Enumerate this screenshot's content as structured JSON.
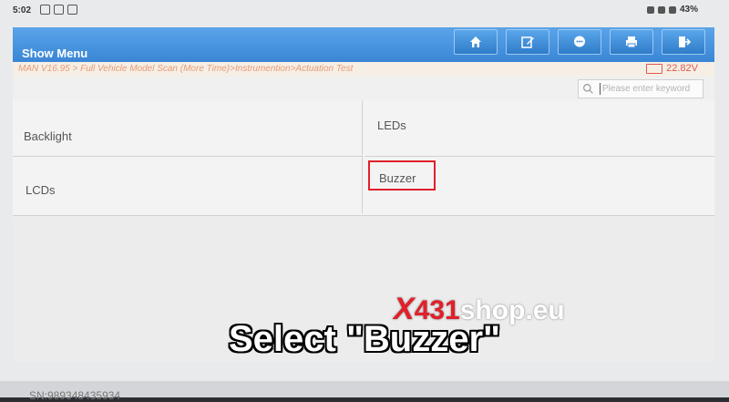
{
  "status_bar": {
    "time": "5:02",
    "battery": "43%"
  },
  "header": {
    "title": "Show Menu",
    "toolbar": [
      {
        "icon": "home-icon"
      },
      {
        "icon": "edit-icon"
      },
      {
        "icon": "chat-icon"
      },
      {
        "icon": "printer-icon"
      },
      {
        "icon": "exit-icon"
      }
    ]
  },
  "path_bar": {
    "path": "MAN V16.95 > Full Vehicle Model Scan (More Time)>Instrumention>Actuation Test",
    "voltage": "22.82V"
  },
  "search": {
    "placeholder": "Please enter keyword"
  },
  "menu_items": [
    "Backlight",
    "LEDs",
    "LCDs",
    "Buzzer"
  ],
  "footer": {
    "serial": "SN:989348435934"
  },
  "watermark": {
    "x": "X",
    "num": "431",
    "rest": "shop.eu"
  },
  "caption": "Select \"Buzzer\"",
  "colors": {
    "header_blue": "#3a86d6",
    "path_orange": "#e79a76",
    "highlight_red": "#e0202a"
  }
}
